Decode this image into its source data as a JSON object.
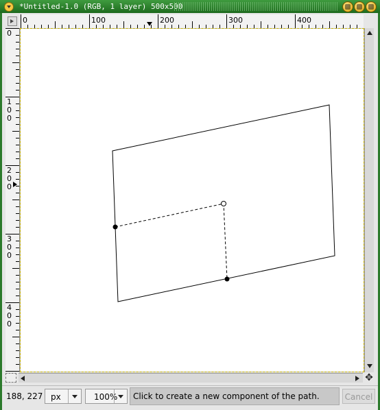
{
  "window": {
    "title": "*Untitled-1.0 (RGB, 1 layer) 500x500"
  },
  "rulers": {
    "horizontal_labels": [
      "0",
      "100",
      "200",
      "300",
      "400"
    ],
    "vertical_labels": [
      "0",
      "1\n0\n0",
      "2\n0\n0",
      "3\n0\n0",
      "4\n0\n0"
    ]
  },
  "status": {
    "pointer_coords": "188, 227",
    "unit": "px",
    "zoom": "100%",
    "message": "Click to create a new component of the path.",
    "cancel_label": "Cancel"
  },
  "icons": {
    "menu": "menu-icon",
    "shade": "shade-icon",
    "maximize": "maximize-icon",
    "close": "close-icon",
    "navigate": "navigate-icon",
    "quick_mask": "quick-mask-icon"
  }
}
